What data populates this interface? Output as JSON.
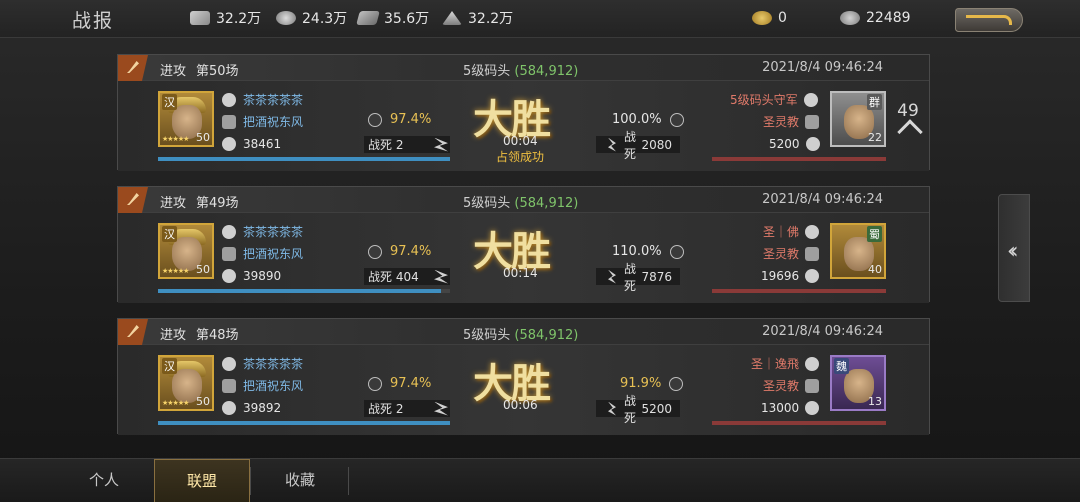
{
  "header": {
    "title": "战报",
    "resources": [
      {
        "icon": "wood-icon",
        "value": "32.2万"
      },
      {
        "icon": "iron-icon",
        "value": "24.3万"
      },
      {
        "icon": "stone-icon",
        "value": "35.6万"
      },
      {
        "icon": "grain-icon",
        "value": "32.2万"
      }
    ],
    "gold": "0",
    "copper": "22489"
  },
  "reports": [
    {
      "type": "进攻",
      "battle": "第50场",
      "location": "5级码头",
      "coord": "(584,912)",
      "time": "2021/8/4 09:46:24",
      "left": {
        "faction": "汉",
        "level": "50",
        "name1": "茶茶茶茶茶",
        "name2": "把酒祝东风",
        "troops": "38461",
        "rate": "97.4%",
        "deaths_label": "战死",
        "deaths": "2",
        "hp_pct": 100
      },
      "right": {
        "faction": "群",
        "level": "22",
        "name1": "5级码头守军",
        "name2": "圣灵教",
        "troops": "5200",
        "rate": "100.0%",
        "deaths_label": "战死",
        "deaths": "2080",
        "hp_pct": 100
      },
      "result": "大胜",
      "duration": "00:04",
      "note": "占领成功",
      "round": "49"
    },
    {
      "type": "进攻",
      "battle": "第49场",
      "location": "5级码头",
      "coord": "(584,912)",
      "time": "2021/8/4 09:46:24",
      "left": {
        "faction": "汉",
        "level": "50",
        "name1": "茶茶茶茶茶",
        "name2": "把酒祝东风",
        "troops": "39890",
        "rate": "97.4%",
        "deaths_label": "战死",
        "deaths": "404",
        "hp_pct": 97
      },
      "right": {
        "faction": "蜀",
        "level": "40",
        "name1": "圣｜佛",
        "name2": "圣灵教",
        "troops": "19696",
        "rate": "110.0%",
        "deaths_label": "战死",
        "deaths": "7876",
        "hp_pct": 100
      },
      "result": "大胜",
      "duration": "00:14",
      "note": ""
    },
    {
      "type": "进攻",
      "battle": "第48场",
      "location": "5级码头",
      "coord": "(584,912)",
      "time": "2021/8/4 09:46:24",
      "left": {
        "faction": "汉",
        "level": "50",
        "name1": "茶茶茶茶茶",
        "name2": "把酒祝东风",
        "troops": "39892",
        "rate": "97.4%",
        "deaths_label": "战死",
        "deaths": "2",
        "hp_pct": 100
      },
      "right": {
        "faction": "魏",
        "level": "13",
        "name1": "圣｜逸飛",
        "name2": "圣灵教",
        "troops": "13000",
        "rate": "91.9%",
        "deaths_label": "战死",
        "deaths": "5200",
        "hp_pct": 100
      },
      "result": "大胜",
      "duration": "00:06",
      "note": ""
    }
  ],
  "tabs": [
    "个人",
    "联盟",
    "收藏"
  ],
  "active_tab": "联盟",
  "colors": {
    "accent": "#e8c154",
    "ally": "#7fb9e6",
    "enemy": "#e07a6a",
    "coord": "#7fc46a"
  }
}
